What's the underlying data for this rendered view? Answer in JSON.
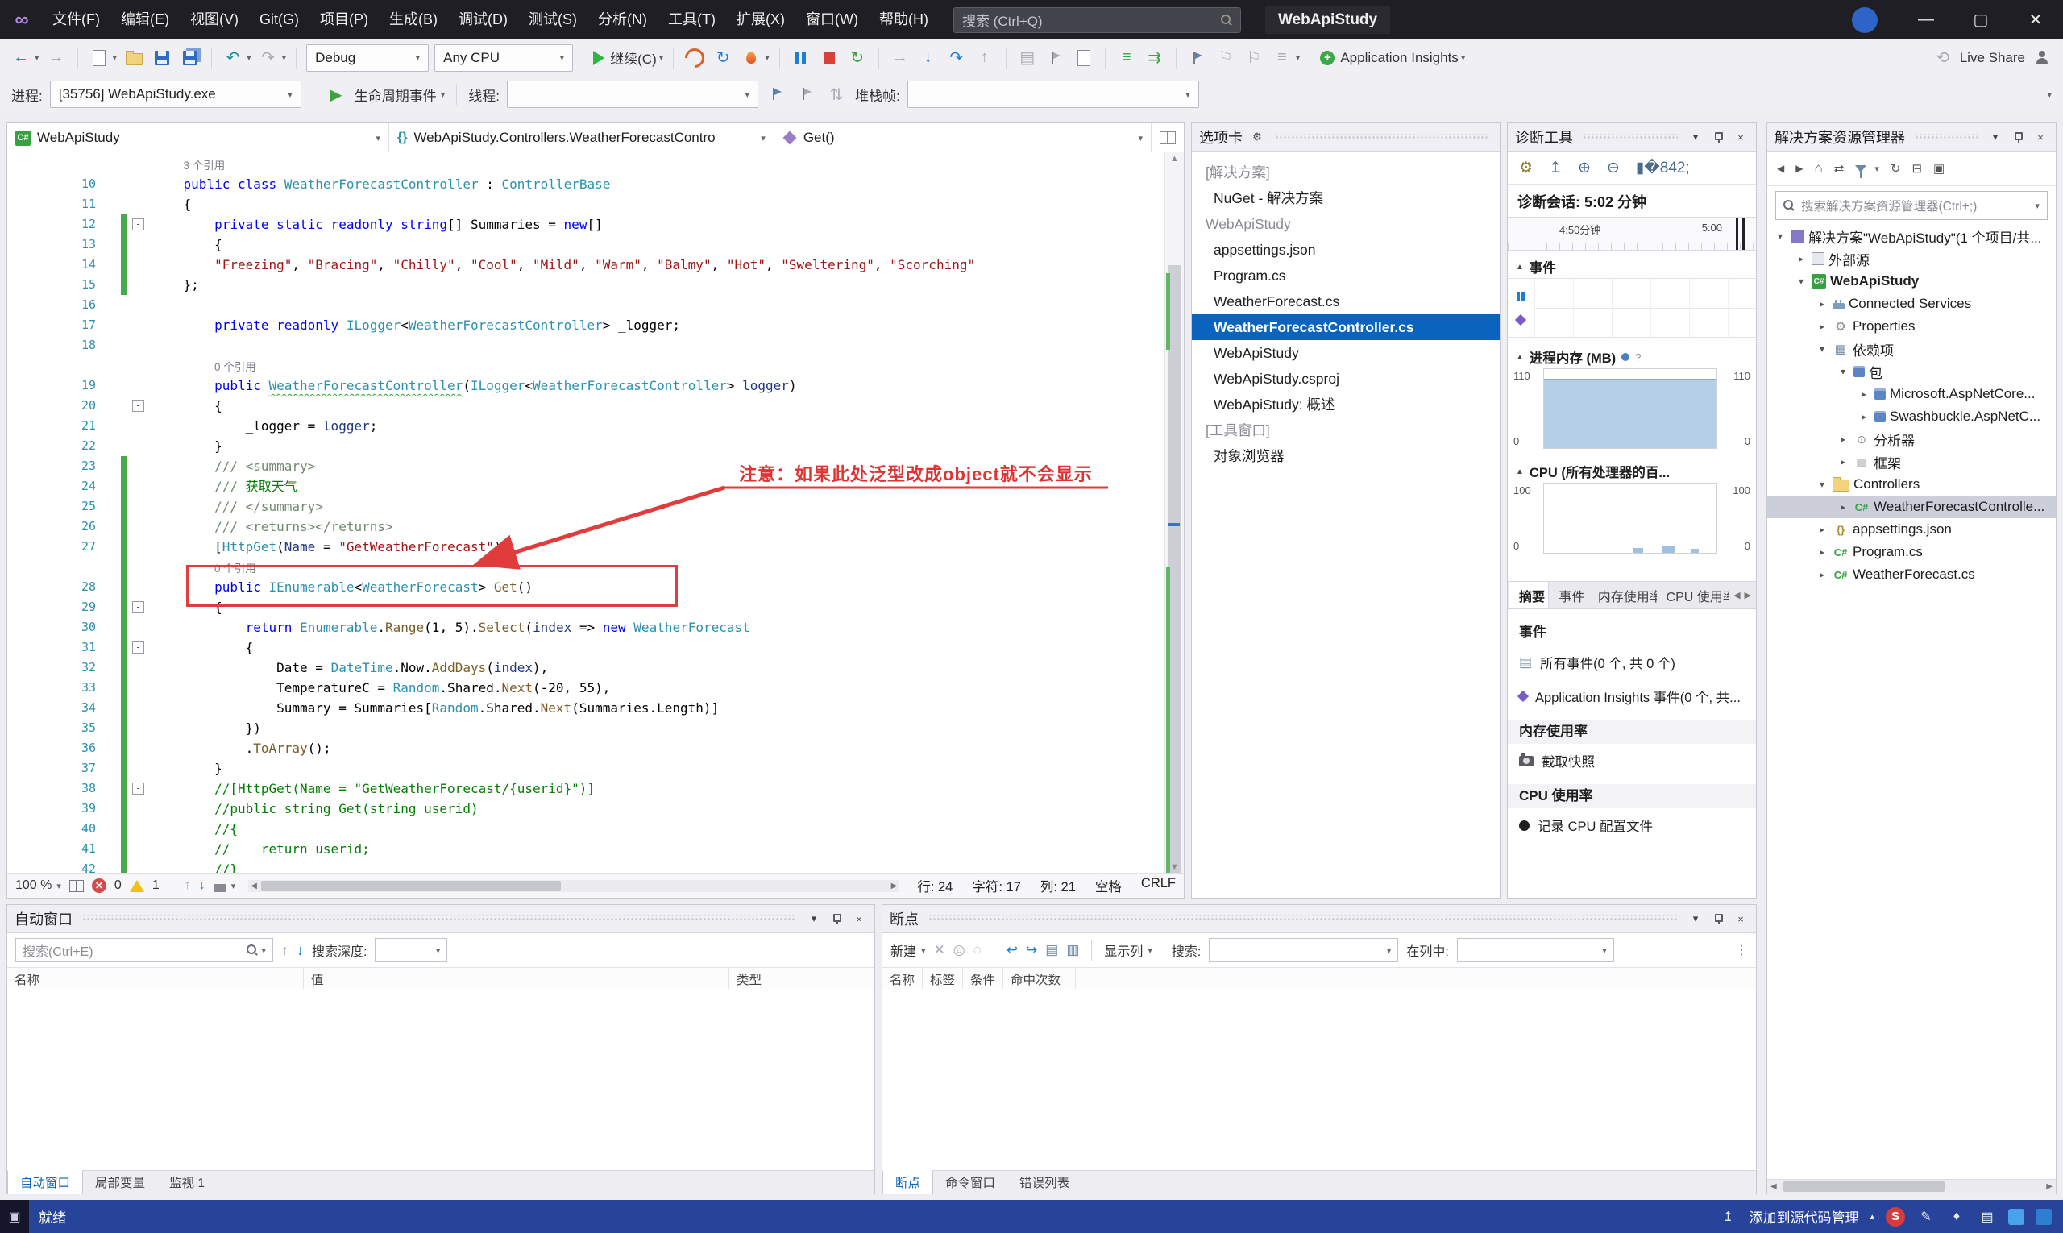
{
  "titlebar": {
    "menus": [
      "文件(F)",
      "编辑(E)",
      "视图(V)",
      "Git(G)",
      "项目(P)",
      "生成(B)",
      "调试(D)",
      "测试(S)",
      "分析(N)",
      "工具(T)",
      "扩展(X)",
      "窗口(W)",
      "帮助(H)"
    ],
    "search_placeholder": "搜索 (Ctrl+Q)",
    "window_title": "WebApiStudy"
  },
  "toolbar": {
    "config": "Debug",
    "platform": "Any CPU",
    "continue_label": "继续(C)",
    "app_insights": "Application Insights",
    "live_share": "Live Share"
  },
  "debugbar": {
    "process_label": "进程:",
    "process_value": "[35756] WebApiStudy.exe",
    "lifecycle": "生命周期事件",
    "thread_label": "线程:",
    "stack_label": "堆栈帧:"
  },
  "breadcrumb": {
    "project": "WebApiStudy",
    "type_path": "WebApiStudy.Controllers.WeatherForecastContro",
    "member": "Get()"
  },
  "editor": {
    "annotation": "注意：如果此处泛型改成object就不会显示",
    "status": {
      "zoom": "100 %",
      "errors": "0",
      "warnings": "1",
      "line": "行: 24",
      "ch": "字符: 17",
      "col": "列: 21",
      "space": "空格",
      "eol": "CRLF"
    },
    "rows": [
      {
        "lens": "3 个引用",
        "ind": 4
      },
      {
        "n": "10",
        "g": [
          [
            "k",
            "    public class "
          ],
          [
            "t",
            "WeatherForecastController"
          ],
          [
            "p",
            " : "
          ],
          [
            "t",
            "ControllerBase"
          ]
        ]
      },
      {
        "n": "11",
        "g": [
          [
            "p",
            "    {"
          ]
        ]
      },
      {
        "n": "12",
        "bar": 1,
        "fold": 1,
        "g": [
          [
            "k",
            "        private static readonly string"
          ],
          [
            "p",
            "[] Summaries = "
          ],
          [
            "k",
            "new"
          ],
          [
            "p",
            "[]"
          ]
        ]
      },
      {
        "n": "13",
        "bar": 1,
        "g": [
          [
            "p",
            "        {"
          ]
        ]
      },
      {
        "n": "14",
        "bar": 1,
        "g": [
          [
            "p",
            "        "
          ],
          [
            "s",
            "\"Freezing\""
          ],
          [
            "p",
            ", "
          ],
          [
            "s",
            "\"Bracing\""
          ],
          [
            "p",
            ", "
          ],
          [
            "s",
            "\"Chilly\""
          ],
          [
            "p",
            ", "
          ],
          [
            "s",
            "\"Cool\""
          ],
          [
            "p",
            ", "
          ],
          [
            "s",
            "\"Mild\""
          ],
          [
            "p",
            ", "
          ],
          [
            "s",
            "\"Warm\""
          ],
          [
            "p",
            ", "
          ],
          [
            "s",
            "\"Balmy\""
          ],
          [
            "p",
            ", "
          ],
          [
            "s",
            "\"Hot\""
          ],
          [
            "p",
            ", "
          ],
          [
            "s",
            "\"Sweltering\""
          ],
          [
            "p",
            ", "
          ],
          [
            "s",
            "\"Scorching\""
          ]
        ]
      },
      {
        "n": "15",
        "bar": 1,
        "g": [
          [
            "p",
            "    };"
          ]
        ]
      },
      {
        "n": "16",
        "g": []
      },
      {
        "n": "17",
        "g": [
          [
            "k",
            "        private readonly "
          ],
          [
            "t",
            "ILogger"
          ],
          [
            "p",
            "<"
          ],
          [
            "t",
            "WeatherForecastController"
          ],
          [
            "p",
            "> _logger;"
          ]
        ]
      },
      {
        "n": "18",
        "g": []
      },
      {
        "lens": "0 个引用",
        "ind": 8
      },
      {
        "n": "19",
        "g": [
          [
            "k",
            "        public "
          ],
          [
            "u",
            "WeatherForecastController"
          ],
          [
            "p",
            "("
          ],
          [
            "t",
            "ILogger"
          ],
          [
            "p",
            "<"
          ],
          [
            "t",
            "WeatherForecastController"
          ],
          [
            "p",
            "> "
          ],
          [
            "v",
            "logger"
          ],
          [
            "p",
            ")"
          ]
        ]
      },
      {
        "n": "20",
        "fold": 1,
        "g": [
          [
            "p",
            "        {"
          ]
        ]
      },
      {
        "n": "21",
        "g": [
          [
            "p",
            "            _logger = "
          ],
          [
            "v",
            "logger"
          ],
          [
            "p",
            ";"
          ]
        ]
      },
      {
        "n": "22",
        "g": [
          [
            "p",
            "        }"
          ]
        ]
      },
      {
        "n": "23",
        "bar": 1,
        "g": [
          [
            "d",
            "        /// <summary>"
          ]
        ]
      },
      {
        "n": "24",
        "bar": 1,
        "g": [
          [
            "d",
            "        /// "
          ],
          [
            "c",
            "获取天气"
          ]
        ]
      },
      {
        "n": "25",
        "bar": 1,
        "g": [
          [
            "d",
            "        /// </summary>"
          ]
        ]
      },
      {
        "n": "26",
        "bar": 1,
        "g": [
          [
            "d",
            "        /// <returns></returns>"
          ]
        ]
      },
      {
        "n": "27",
        "bar": 1,
        "g": [
          [
            "p",
            "        ["
          ],
          [
            "t",
            "HttpGet"
          ],
          [
            "p",
            "("
          ],
          [
            "v",
            "Name"
          ],
          [
            "p",
            " = "
          ],
          [
            "s",
            "\"GetWeatherForecast\""
          ],
          [
            "p",
            ")]"
          ]
        ]
      },
      {
        "lens": "0 个引用",
        "ind": 8,
        "bar": 1
      },
      {
        "n": "28",
        "bar": 1,
        "g": [
          [
            "k",
            "        public "
          ],
          [
            "t",
            "IEnumerable"
          ],
          [
            "p",
            "<"
          ],
          [
            "t",
            "WeatherForecast"
          ],
          [
            "p",
            "> "
          ],
          [
            "m",
            "Get"
          ],
          [
            "p",
            "()"
          ]
        ]
      },
      {
        "n": "29",
        "bar": 1,
        "fold": 1,
        "g": [
          [
            "p",
            "        {"
          ]
        ]
      },
      {
        "n": "30",
        "bar": 1,
        "g": [
          [
            "k",
            "            return "
          ],
          [
            "t",
            "Enumerable"
          ],
          [
            "p",
            "."
          ],
          [
            "m",
            "Range"
          ],
          [
            "p",
            "(1, 5)."
          ],
          [
            "m",
            "Select"
          ],
          [
            "p",
            "("
          ],
          [
            "v",
            "index"
          ],
          [
            "p",
            " => "
          ],
          [
            "k",
            "new"
          ],
          [
            "p",
            " "
          ],
          [
            "t",
            "WeatherForecast"
          ]
        ]
      },
      {
        "n": "31",
        "bar": 1,
        "fold": 1,
        "g": [
          [
            "p",
            "            {"
          ]
        ]
      },
      {
        "n": "32",
        "bar": 1,
        "g": [
          [
            "p",
            "                Date = "
          ],
          [
            "t",
            "DateTime"
          ],
          [
            "p",
            ".Now."
          ],
          [
            "m",
            "AddDays"
          ],
          [
            "p",
            "("
          ],
          [
            "v",
            "index"
          ],
          [
            "p",
            "),"
          ]
        ]
      },
      {
        "n": "33",
        "bar": 1,
        "g": [
          [
            "p",
            "                TemperatureC = "
          ],
          [
            "t",
            "Random"
          ],
          [
            "p",
            ".Shared."
          ],
          [
            "m",
            "Next"
          ],
          [
            "p",
            "(-20, 55),"
          ]
        ]
      },
      {
        "n": "34",
        "bar": 1,
        "g": [
          [
            "p",
            "                Summary = Summaries["
          ],
          [
            "t",
            "Random"
          ],
          [
            "p",
            ".Shared."
          ],
          [
            "m",
            "Next"
          ],
          [
            "p",
            "(Summaries.Length)]"
          ]
        ]
      },
      {
        "n": "35",
        "bar": 1,
        "g": [
          [
            "p",
            "            })"
          ]
        ]
      },
      {
        "n": "36",
        "bar": 1,
        "g": [
          [
            "p",
            "            ."
          ],
          [
            "m",
            "ToArray"
          ],
          [
            "p",
            "();"
          ]
        ]
      },
      {
        "n": "37",
        "bar": 1,
        "g": [
          [
            "p",
            "        }"
          ]
        ]
      },
      {
        "n": "38",
        "bar": 1,
        "fold": 1,
        "g": [
          [
            "c",
            "        //[HttpGet(Name = \"GetWeatherForecast/{userid}\")]"
          ]
        ]
      },
      {
        "n": "39",
        "bar": 1,
        "g": [
          [
            "c",
            "        //public string Get(string userid)"
          ]
        ]
      },
      {
        "n": "40",
        "bar": 1,
        "g": [
          [
            "c",
            "        //{"
          ]
        ]
      },
      {
        "n": "41",
        "bar": 1,
        "g": [
          [
            "c",
            "        //    return userid;"
          ]
        ]
      },
      {
        "n": "42",
        "bar": 1,
        "g": [
          [
            "c",
            "        //}"
          ]
        ]
      }
    ]
  },
  "tabs_panel": {
    "title": "选项卡",
    "items": [
      {
        "kind": "header",
        "label": "[解决方案]"
      },
      {
        "kind": "item",
        "label": "NuGet - 解决方案"
      },
      {
        "kind": "header",
        "label": "WebApiStudy"
      },
      {
        "kind": "item",
        "label": "appsettings.json"
      },
      {
        "kind": "item",
        "label": "Program.cs"
      },
      {
        "kind": "item",
        "label": "WeatherForecast.cs"
      },
      {
        "kind": "item",
        "label": "WeatherForecastController.cs",
        "selected": true
      },
      {
        "kind": "item",
        "label": "WebApiStudy"
      },
      {
        "kind": "item",
        "label": "WebApiStudy.csproj"
      },
      {
        "kind": "item",
        "label": "WebApiStudy: 概述"
      },
      {
        "kind": "header",
        "label": "[工具窗口]"
      },
      {
        "kind": "item",
        "label": "对象浏览器"
      }
    ]
  },
  "diagnostics": {
    "title": "诊断工具",
    "session": "诊断会话: 5:02 分钟",
    "timeline": {
      "left": "4:50分钟",
      "right": "5:00"
    },
    "events_section": "事件",
    "memory_section": "进程内存 (MB)",
    "memory_axis": {
      "top_left": "110",
      "bottom_left": "0",
      "top_right": "110",
      "bottom_right": "0"
    },
    "cpu_section": "CPU (所有处理器的百...",
    "cpu_axis": {
      "top_left": "100",
      "bottom_left": "0",
      "top_right": "100",
      "bottom_right": "0"
    },
    "tabs": [
      "摘要",
      "事件",
      "内存使用率",
      "CPU 使用率"
    ],
    "summary": {
      "events_heading": "事件",
      "all_events": "所有事件(0 个, 共 0 个)",
      "ai_events": "Application Insights 事件(0 个, 共...",
      "memory_heading": "内存使用率",
      "snapshot": "截取快照",
      "cpu_heading": "CPU 使用率",
      "record": "记录 CPU 配置文件"
    }
  },
  "solution_explorer": {
    "title": "解决方案资源管理器",
    "search_placeholder": "搜索解决方案资源管理器(Ctrl+;)",
    "tree": [
      {
        "indent": 0,
        "exp": "open",
        "icon": "sln",
        "label": "解决方案\"WebApiStudy\"(1 个项目/共..."
      },
      {
        "indent": 1,
        "exp": "closed",
        "icon": "ext",
        "label": "外部源"
      },
      {
        "indent": 1,
        "exp": "open",
        "icon": "csproj",
        "label": "WebApiStudy",
        "bold": true
      },
      {
        "indent": 2,
        "exp": "closed",
        "icon": "plug",
        "label": "Connected Services"
      },
      {
        "indent": 2,
        "exp": "closed",
        "icon": "wrench",
        "label": "Properties"
      },
      {
        "indent": 2,
        "exp": "open",
        "icon": "deps",
        "label": "依赖项"
      },
      {
        "indent": 3,
        "exp": "open",
        "icon": "pkg",
        "label": "包"
      },
      {
        "indent": 4,
        "exp": "closed",
        "icon": "pkg",
        "label": "Microsoft.AspNetCore..."
      },
      {
        "indent": 4,
        "exp": "closed",
        "icon": "pkg",
        "label": "Swashbuckle.AspNetC..."
      },
      {
        "indent": 3,
        "exp": "closed",
        "icon": "analyzer",
        "label": "分析器"
      },
      {
        "indent": 3,
        "exp": "closed",
        "icon": "fw",
        "label": "框架"
      },
      {
        "indent": 2,
        "exp": "open",
        "icon": "folder",
        "label": "Controllers"
      },
      {
        "indent": 3,
        "exp": "closed",
        "icon": "cs",
        "label": "WeatherForecastControlle...",
        "selected": true
      },
      {
        "indent": 2,
        "exp": "closed",
        "icon": "json",
        "label": "appsettings.json"
      },
      {
        "indent": 2,
        "exp": "closed",
        "icon": "cs",
        "label": "Program.cs"
      },
      {
        "indent": 2,
        "exp": "closed",
        "icon": "cs",
        "label": "WeatherForecast.cs"
      }
    ]
  },
  "autos": {
    "title": "自动窗口",
    "search_placeholder": "搜索(Ctrl+E)",
    "depth_label": "搜索深度:",
    "columns": [
      "名称",
      "值",
      "类型"
    ],
    "tabs": [
      "自动窗口",
      "局部变量",
      "监视 1"
    ]
  },
  "breakpoints": {
    "title": "断点",
    "new_label": "新建",
    "columns_label": "显示列",
    "search_label": "搜索:",
    "incol_label": "在列中:",
    "columns": [
      "名称",
      "标签",
      "条件",
      "命中次数"
    ],
    "tabs": [
      "断点",
      "命令窗口",
      "错误列表"
    ]
  },
  "statusbar": {
    "ready": "就绪",
    "source_control": "添加到源代码管理"
  },
  "colors": {
    "selection_blue": "#0a64bd",
    "change_green": "#4aa94a",
    "annotation_red": "#e23b3b",
    "status_blue": "#27439a",
    "keyword_blue": "#0000ff",
    "type_teal": "#2b91af",
    "string_red": "#a31515",
    "comment_green": "#008000"
  }
}
